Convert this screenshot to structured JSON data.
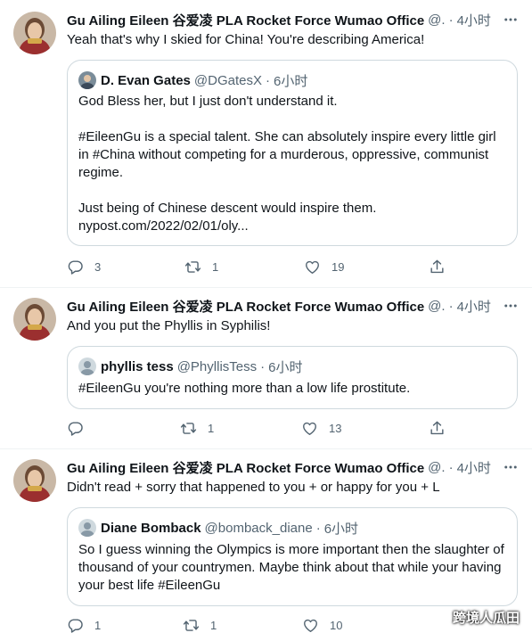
{
  "tweets": [
    {
      "author": "Gu Ailing Eileen 谷爱凌 PLA Rocket Force Wumao Office",
      "handle": "@.",
      "sep": "·",
      "time": "4小时",
      "text": "Yeah that's why I skied for China! You're describing America!",
      "quote": {
        "author": "D. Evan Gates",
        "handle": "@DGatesX",
        "sep": "·",
        "time": "6小时",
        "lines": [
          "God Bless her, but I just don't understand it.",
          "",
          "#EileenGu is a special talent. She can absolutely inspire every little girl",
          "in #China without competing for a murderous, oppressive, communist",
          "regime.",
          "",
          "Just being of Chinese descent would inspire them.",
          "nypost.com/2022/02/01/oly..."
        ]
      },
      "replies": "3",
      "retweets": "1",
      "likes": "19"
    },
    {
      "author": "Gu Ailing Eileen 谷爱凌 PLA Rocket Force Wumao Office",
      "handle": "@.",
      "sep": "·",
      "time": "4小时",
      "text": "And you put the Phyllis in Syphilis!",
      "quote": {
        "author": "phyllis tess",
        "handle": "@PhyllisTess",
        "sep": "·",
        "time": "6小时",
        "lines": [
          "#EileenGu you're nothing more than a low life prostitute."
        ]
      },
      "replies": "",
      "retweets": "1",
      "likes": "13"
    },
    {
      "author": "Gu Ailing Eileen 谷爱凌 PLA Rocket Force Wumao Office",
      "handle": "@.",
      "sep": "·",
      "time": "4小时",
      "text": "Didn't read + sorry that happened to you + or happy for you + L",
      "quote": {
        "author": "Diane Bomback",
        "handle": "@bomback_diane",
        "sep": "·",
        "time": "6小时",
        "lines": [
          "So I guess winning the Olympics is more important then the slaughter of",
          "thousand of your countrymen. Maybe think about that while your having",
          "your best life #EileenGu"
        ]
      },
      "replies": "1",
      "retweets": "1",
      "likes": "10"
    }
  ],
  "watermark": "跨境人瓜田",
  "icons": {
    "more": "more-horizontal-icon",
    "reply": "reply-icon",
    "retweet": "retweet-icon",
    "like": "heart-icon",
    "share": "share-icon"
  },
  "colors": {
    "text": "#0f1419",
    "secondary": "#536471",
    "border": "#cfd9de",
    "divider": "#eff3f4"
  }
}
